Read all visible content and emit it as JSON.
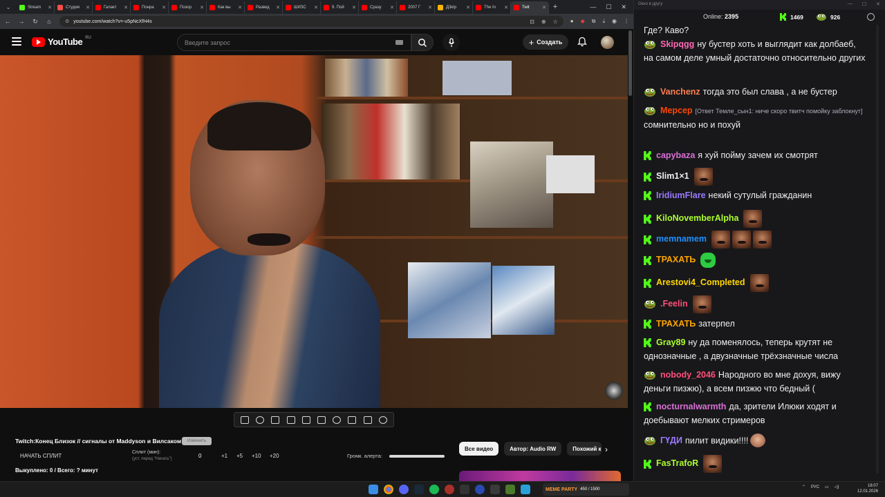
{
  "browser": {
    "tabs": [
      {
        "label": "Stream",
        "color": "#53fc18"
      },
      {
        "label": "Студия",
        "color": "#ff4e45"
      },
      {
        "label": "Галакт",
        "color": "#ff0000"
      },
      {
        "label": "Понра",
        "color": "#ff0000"
      },
      {
        "label": "Позор",
        "color": "#ff0000"
      },
      {
        "label": "Как вы",
        "color": "#ff0000"
      },
      {
        "label": "Развед",
        "color": "#ff0000"
      },
      {
        "label": "ШИЗС",
        "color": "#ff0000"
      },
      {
        "label": "9. Пой",
        "color": "#ff0000"
      },
      {
        "label": "Сразу",
        "color": "#ff0000"
      },
      {
        "label": "2007 Г",
        "color": "#ff0000"
      },
      {
        "label": "Д3кІр",
        "color": "#ffb400"
      },
      {
        "label": "The In",
        "color": "#ff0000"
      },
      {
        "label": "Twit",
        "color": "#ff0000"
      }
    ],
    "url": "youtube.com/watch?v=-u5pNcXfH4s"
  },
  "youtube": {
    "logo_text": "YouTube",
    "region": "RU",
    "search_placeholder": "Введите запрос",
    "create_label": "Создать",
    "video_title": "Twitch:Конец Близок // сигналы от Maddyson и Вилсаком",
    "title_pill": "Изменить",
    "split": {
      "start_label": "НАЧАТЬ СПЛИТ",
      "split_label": "Сплит (мин):",
      "split_hint": "(уст. перед \"Начать\")",
      "value": "0",
      "increments": [
        "+1",
        "+5",
        "+10",
        "+20"
      ],
      "alert_label": "Громк. алерта:"
    },
    "purchased": "Выкуплено: 0 / Всего: ? минут",
    "chips": [
      "Все видео",
      "Автор: Audio RW",
      "Похожий к"
    ]
  },
  "chat": {
    "window_title": "Окно в другу",
    "online_label": "Online:",
    "online_count": "2395",
    "kick_count": "1469",
    "pepe_count": "926",
    "messages": [
      {
        "user": "",
        "text": "Где? Каво?",
        "badge": "none",
        "color": "#efeff1"
      },
      {
        "user": "Skipqgg",
        "text": "ну бустер хоть и выглядит как долбаеб, на самом деле умный достаточно относительно других",
        "badge": "p",
        "color": "#ff69b4"
      },
      {
        "user": "Vanchenz",
        "text": "тогда это был слава , а не бустер",
        "badge": "p",
        "color": "#ff7f50"
      },
      {
        "user": "Мерсер",
        "reply": "[Ответ Темле_сын1: ниче скоро твитч помойку заблокнут]",
        "text": "сомнительно но и похуй",
        "badge": "p",
        "color": "#ff4500"
      },
      {
        "user": "capybaza",
        "text": "я хуй пойму зачем их смотрят",
        "badge": "k",
        "color": "#da70d6"
      },
      {
        "user": "Slim1×1",
        "text": "",
        "badge": "k",
        "color": "#efeff1",
        "emotes": 1
      },
      {
        "user": "IridiumFlare",
        "text": "некий сутулый гражданин",
        "badge": "k",
        "color": "#9b7bff"
      },
      {
        "user": "KiloNovemberAlpha",
        "text": "",
        "badge": "k",
        "color": "#adff2f",
        "emotes": 1
      },
      {
        "user": "memnamem",
        "text": "",
        "badge": "k",
        "color": "#1e90ff",
        "emotes": 3
      },
      {
        "user": "ТРАХАТЬ",
        "text": "",
        "badge": "k",
        "color": "#ffa500",
        "emotes": 1,
        "green": true
      },
      {
        "user": "Arestovi4_Completed",
        "text": "",
        "badge": "k",
        "color": "#ffd700",
        "emotes": 1
      },
      {
        "user": ".Feelin",
        "text": "",
        "badge": "p",
        "color": "#ff4f7a",
        "emotes": 1
      },
      {
        "user": "ТРАХАТЬ",
        "text": "затерпел",
        "badge": "k",
        "color": "#ffa500"
      },
      {
        "user": "Gray89",
        "text": "ну да поменялось, теперь крутят не однозначные , а двузначные трёхзначные числа",
        "badge": "k",
        "color": "#adff2f"
      },
      {
        "user": "nobody_2046",
        "text": "Народного во мне дохуя, вижу деньги пизжю), а всем пизжю что бедный (",
        "badge": "p",
        "color": "#ff4f7a"
      },
      {
        "user": "nocturnalwarmth",
        "text": "да, зрители Илюки ходят и доебывают мелких стримеров",
        "badge": "k",
        "color": "#da70d6"
      },
      {
        "user": "ГҮДИ",
        "text": "пилит видики!!!!",
        "badge": "p",
        "color": "#9b7bff",
        "face": true
      },
      {
        "user": "FasTrafoR",
        "text": "",
        "badge": "k",
        "color": "#adff2f",
        "emotes": 1
      }
    ]
  },
  "taskbar": {
    "widget_title": "MEME PARTY",
    "widget_value": "450 / 1500",
    "lang": "РУС",
    "time": "18:07",
    "date": "12.01.2026"
  },
  "colors": {
    "kick_green": "#53fc18",
    "yt_red": "#ff0000"
  }
}
